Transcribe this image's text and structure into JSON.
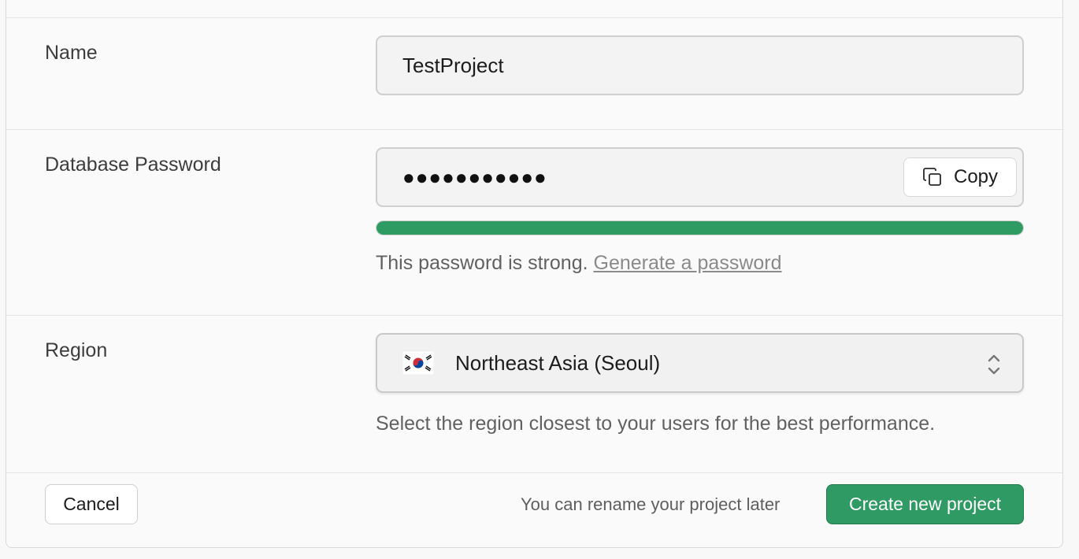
{
  "form": {
    "name": {
      "label": "Name",
      "value": "TestProject"
    },
    "password": {
      "label": "Database Password",
      "masked_value": "●●●●●●●●●●●",
      "copy_label": "Copy",
      "strength_fraction": 1.0,
      "strength_color": "#2e9b62",
      "strength_text": "This password is strong.",
      "generate_link": "Generate a password"
    },
    "region": {
      "label": "Region",
      "selected": "Northeast Asia (Seoul)",
      "flag_icon": "south-korea-flag-icon",
      "help_text": "Select the region closest to your users for the best performance."
    }
  },
  "footer": {
    "cancel_label": "Cancel",
    "note": "You can rename your project later",
    "create_label": "Create new project",
    "accent_color": "#2f9a63"
  }
}
